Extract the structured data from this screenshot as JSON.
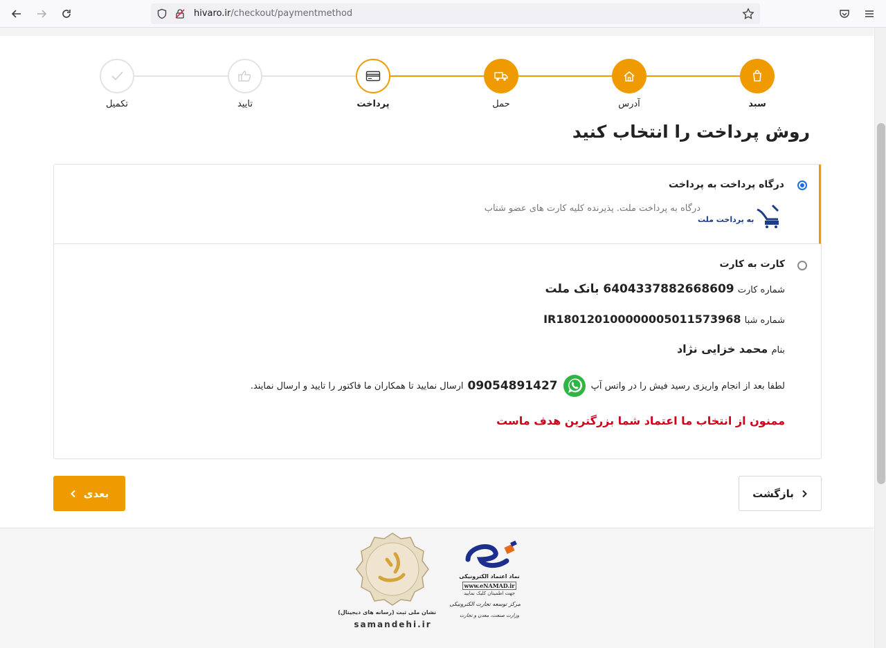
{
  "browser": {
    "url_domain": "hivaro.ir",
    "url_path": "/checkout/paymentmethod"
  },
  "stepper": {
    "steps": [
      {
        "label": "سبد",
        "state": "done",
        "icon": "bag-icon"
      },
      {
        "label": "آدرس",
        "state": "done",
        "icon": "home-icon"
      },
      {
        "label": "حمل",
        "state": "done",
        "icon": "truck-icon"
      },
      {
        "label": "پرداخت",
        "state": "current",
        "icon": "credit-card-icon"
      },
      {
        "label": "تایید",
        "state": "todo",
        "icon": "thumbs-up-icon"
      },
      {
        "label": "تکمیل",
        "state": "todo",
        "icon": "check-icon"
      }
    ],
    "accent_color": "#ef9b00"
  },
  "page_title": "روش پرداخت را انتخاب کنید",
  "options": {
    "gateway": {
      "title": "درگاه پرداخت به پرداخت",
      "description": "درگاه به پرداخت ملت. پذیرنده کلیه کارت های عضو شتاب",
      "logo_text": "به پرداخت ملت",
      "selected": true
    },
    "card_to_card": {
      "title": "کارت به کارت",
      "card_label": "شماره کارت",
      "card_value": "6404337882668609 بانک ملت",
      "sheba_label": "شماره شبا",
      "sheba_value": "IR180120100000005011573968",
      "owner_label": "بنام",
      "owner_value": "محمد خزایی نژاد",
      "note_before": "لطفا بعد از انجام واریزی رسید فیش را در واتس آپ",
      "phone": "09054891427",
      "note_after": "ارسال نمایید تا همکاران ما فاکتور را تایید و ارسال نمایند.",
      "thanks": "ممنون از انتخاب ما اعتماد شما بزرگترین هدف ماست",
      "thanks_color": "#d0021b",
      "selected": false
    }
  },
  "buttons": {
    "back": "بازگشت",
    "next": "بعدی"
  },
  "footer": {
    "samandehi_caption": "نشان ملی ثبت (رسانه های دیجیتال)",
    "samandehi_domain": "samandehi.ir",
    "enamad_title": "نماد اعتماد الکترونیکی",
    "enamad_url": "www.eNAMAD.ir",
    "enamad_hint": "جهت اطمینان کلیک نمایید",
    "enamad_org": "مرکز توسعه تجارت الکترونیکی",
    "enamad_ministry": "وزارت صنعت، معدن و تجارت"
  }
}
